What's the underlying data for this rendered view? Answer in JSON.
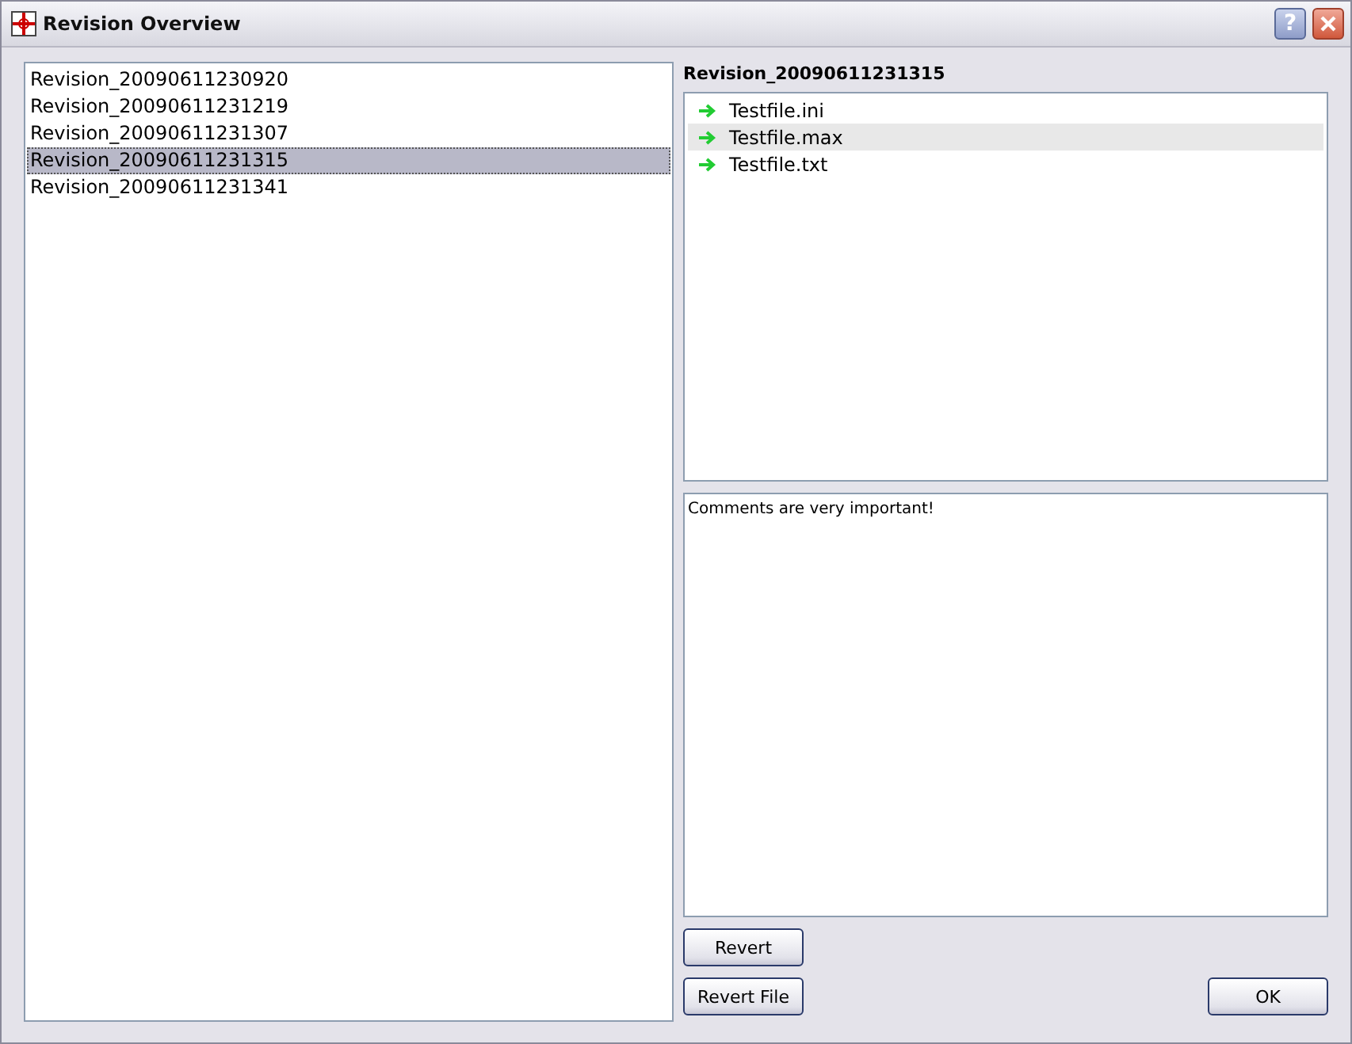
{
  "window": {
    "title": "Revision Overview",
    "help_button": "?"
  },
  "revisions": [
    {
      "label": "Revision_20090611230920",
      "selected": false
    },
    {
      "label": "Revision_20090611231219",
      "selected": false
    },
    {
      "label": "Revision_20090611231307",
      "selected": false
    },
    {
      "label": "Revision_20090611231315",
      "selected": true
    },
    {
      "label": "Revision_20090611231341",
      "selected": false
    }
  ],
  "detail": {
    "title": "Revision_20090611231315",
    "files": [
      {
        "name": "Testfile.ini",
        "selected": false
      },
      {
        "name": "Testfile.max",
        "selected": true
      },
      {
        "name": "Testfile.txt",
        "selected": false
      }
    ],
    "comment": "Comments are very important!"
  },
  "buttons": {
    "revert": "Revert",
    "revert_file": "Revert File",
    "ok": "OK"
  }
}
